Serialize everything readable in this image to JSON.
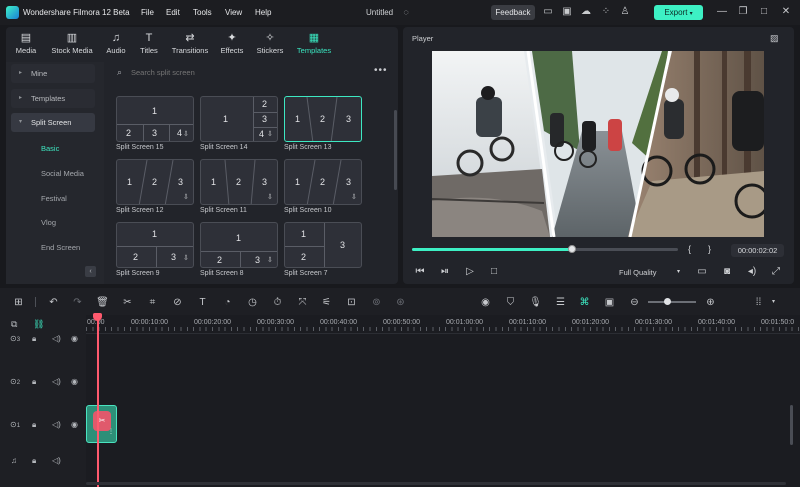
{
  "app": {
    "title": "Wondershare Filmora 12 Beta",
    "menu": [
      "File",
      "Edit",
      "Tools",
      "View",
      "Help"
    ],
    "document_title": "Untitled",
    "feedback_label": "Feedback",
    "export_label": "Export",
    "accent_color": "#3df0c4"
  },
  "tabs": [
    {
      "label": "Media",
      "icon": "media-icon"
    },
    {
      "label": "Stock Media",
      "icon": "stock-media-icon"
    },
    {
      "label": "Audio",
      "icon": "music-note-icon"
    },
    {
      "label": "Titles",
      "icon": "title-t-icon"
    },
    {
      "label": "Transitions",
      "icon": "transition-arrows-icon"
    },
    {
      "label": "Effects",
      "icon": "sparkle-icon"
    },
    {
      "label": "Stickers",
      "icon": "sticker-icon"
    },
    {
      "label": "Templates",
      "icon": "templates-icon",
      "active": true
    }
  ],
  "sidebar": {
    "items": [
      "Mine",
      "Templates",
      "Split Screen"
    ],
    "sub_items": [
      "Basic",
      "Social Media",
      "Festival",
      "Vlog",
      "End Screen"
    ],
    "active_sub": "Basic"
  },
  "search": {
    "placeholder": "Search split screen"
  },
  "templates": [
    {
      "name": "Split Screen 15"
    },
    {
      "name": "Split Screen 14"
    },
    {
      "name": "Split Screen 13",
      "selected": true
    },
    {
      "name": "Split Screen 12"
    },
    {
      "name": "Split Screen 11"
    },
    {
      "name": "Split Screen 10"
    },
    {
      "name": "Split Screen 9"
    },
    {
      "name": "Split Screen 8"
    },
    {
      "name": "Split Screen 7"
    }
  ],
  "player": {
    "label": "Player",
    "timecode": "00:00:02:02",
    "quality": "Full Quality",
    "progress": 0.6
  },
  "timeline": {
    "ruler": [
      "00:00",
      "00:00:10:00",
      "00:00:20:00",
      "00:00:30:00",
      "00:00:40:00",
      "00:00:50:00",
      "00:01:00:00",
      "00:01:10:00",
      "00:01:20:00",
      "00:01:30:00",
      "00:01:40:00",
      "00:01:50:0"
    ],
    "tracks": [
      "3",
      "2",
      "1"
    ]
  }
}
